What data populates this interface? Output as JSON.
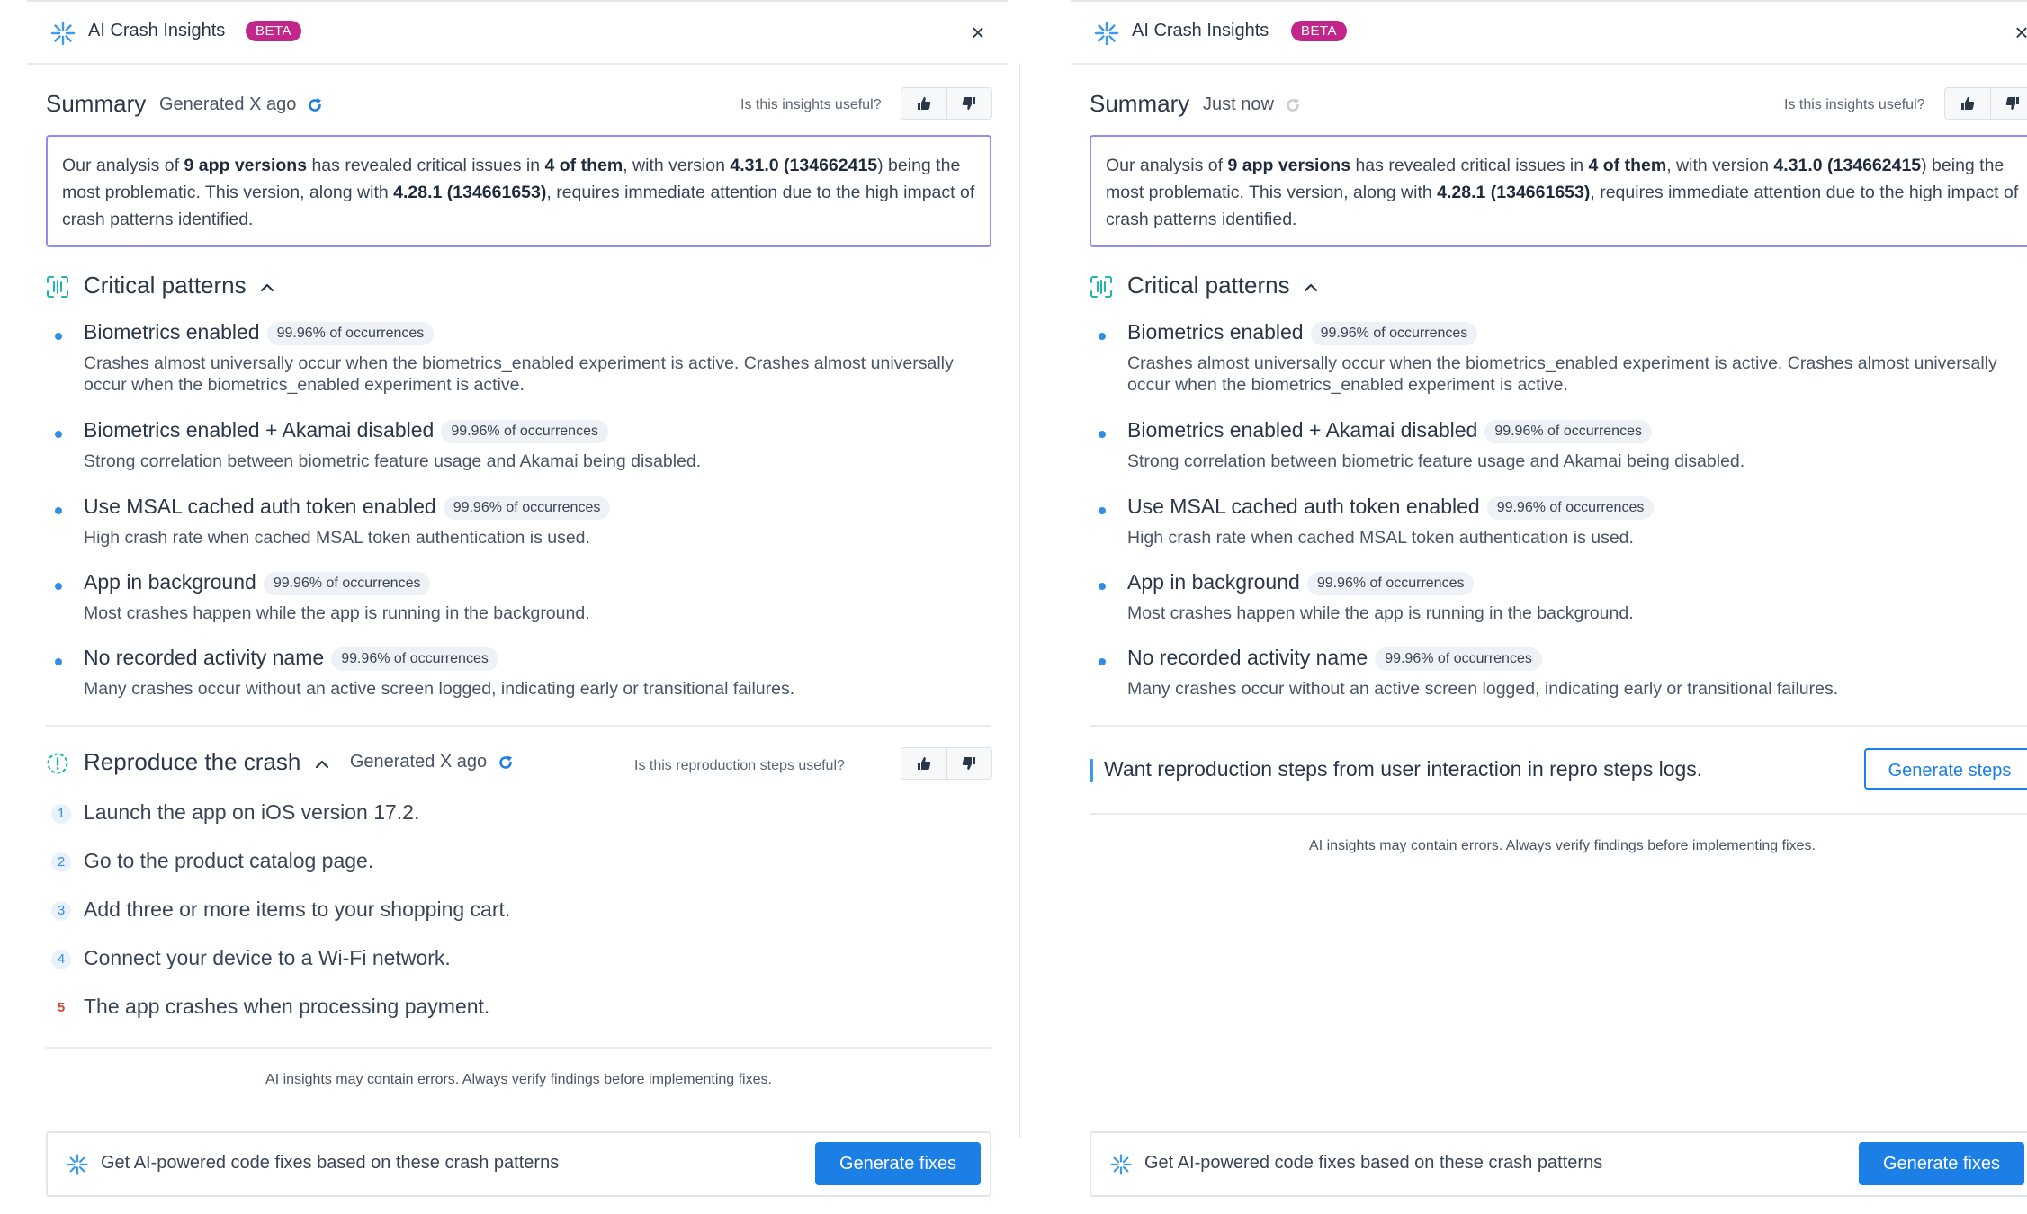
{
  "panels": [
    {
      "header": {
        "title": "AI Crash Insights",
        "badge": "BETA",
        "close": "×"
      },
      "summary": {
        "title": "Summary",
        "generated": "Generated X ago",
        "useful_question": "Is this insights useful?",
        "text": {
          "t1": "Our analysis of ",
          "b1": "9 app versions",
          "t2": " has revealed critical issues in ",
          "b2": "4 of them",
          "t3": ", with version ",
          "b3": "4.31.0 (134662415",
          "t4": ") being the most problematic. This version, along with ",
          "b4": "4.28.1 (134661653)",
          "t5": ", requires immediate attention due to the high impact of crash patterns identified."
        }
      },
      "critical": {
        "title": "Critical patterns"
      },
      "patterns": [
        {
          "title": "Biometrics enabled",
          "pill": "99.96% of occurrences",
          "desc": "Crashes almost universally occur when the biometrics_enabled experiment is active. Crashes almost universally occur when the biometrics_enabled experiment is active."
        },
        {
          "title": "Biometrics enabled + Akamai disabled",
          "pill": "99.96% of occurrences",
          "desc": "Strong correlation between biometric feature usage and Akamai being disabled."
        },
        {
          "title": "Use MSAL cached auth token enabled",
          "pill": "99.96% of occurrences",
          "desc": "High crash rate when cached MSAL token authentication is used."
        },
        {
          "title": "App in background",
          "pill": "99.96% of occurrences",
          "desc": "Most crashes happen while the app is running in the background."
        },
        {
          "title": "No recorded activity name",
          "pill": "99.96% of occurrences",
          "desc": "Many crashes occur without an active screen logged, indicating early or transitional failures."
        }
      ],
      "repro": {
        "title": "Reproduce the crash",
        "generated": "Generated X ago",
        "useful_question": "Is this reproduction steps useful?",
        "steps": [
          {
            "num": "1",
            "text": "Launch the app on iOS version 17.2."
          },
          {
            "num": "2",
            "text": "Go to the product catalog page."
          },
          {
            "num": "3",
            "text": "Add three or more items to your shopping cart."
          },
          {
            "num": "4",
            "text": "Connect your device to a Wi-Fi network."
          },
          {
            "num": "5",
            "text": "The app crashes when processing payment."
          }
        ]
      },
      "disclaimer": "AI insights may contain errors. Always verify findings before implementing fixes.",
      "fix_bar": {
        "text": "Get AI-powered code fixes based on these crash patterns",
        "button": "Generate fixes"
      }
    },
    {
      "header": {
        "title": "AI Crash Insights",
        "badge": "BETA",
        "close": "×"
      },
      "summary": {
        "title": "Summary",
        "generated": "Just now",
        "useful_question": "Is this insights useful?",
        "text": {
          "t1": "Our analysis of ",
          "b1": "9 app versions",
          "t2": " has revealed critical issues in ",
          "b2": "4 of them",
          "t3": ", with version ",
          "b3": "4.31.0 (134662415",
          "t4": ") being the most problematic. This version, along with ",
          "b4": "4.28.1 (134661653)",
          "t5": ", requires immediate attention due to the high impact of crash patterns identified."
        }
      },
      "critical": {
        "title": "Critical patterns"
      },
      "patterns": [
        {
          "title": "Biometrics enabled",
          "pill": "99.96% of occurrences",
          "desc": "Crashes almost universally occur when the biometrics_enabled experiment is active. Crashes almost universally occur when the biometrics_enabled experiment is active."
        },
        {
          "title": "Biometrics enabled + Akamai disabled",
          "pill": "99.96% of occurrences",
          "desc": "Strong correlation between biometric feature usage and Akamai being disabled."
        },
        {
          "title": "Use MSAL cached auth token enabled",
          "pill": "99.96% of occurrences",
          "desc": "High crash rate when cached MSAL token authentication is used."
        },
        {
          "title": "App in background",
          "pill": "99.96% of occurrences",
          "desc": "Most crashes happen while the app is running in the background."
        },
        {
          "title": "No recorded activity name",
          "pill": "99.96% of occurrences",
          "desc": "Many crashes occur without an active screen logged, indicating early or transitional failures."
        }
      ],
      "want_steps": {
        "text": "Want reproduction steps from user interaction in repro steps logs.",
        "button": "Generate steps"
      },
      "disclaimer": "AI insights may contain errors. Always verify findings before implementing fixes.",
      "fix_bar": {
        "text": "Get AI-powered code fixes based on these crash patterns",
        "button": "Generate fixes"
      }
    }
  ],
  "colors": {
    "accent": "#1b7fe6",
    "beta_badge": "#c2268a",
    "summary_border": "#8f8ef0",
    "step5": "#e0432f"
  }
}
